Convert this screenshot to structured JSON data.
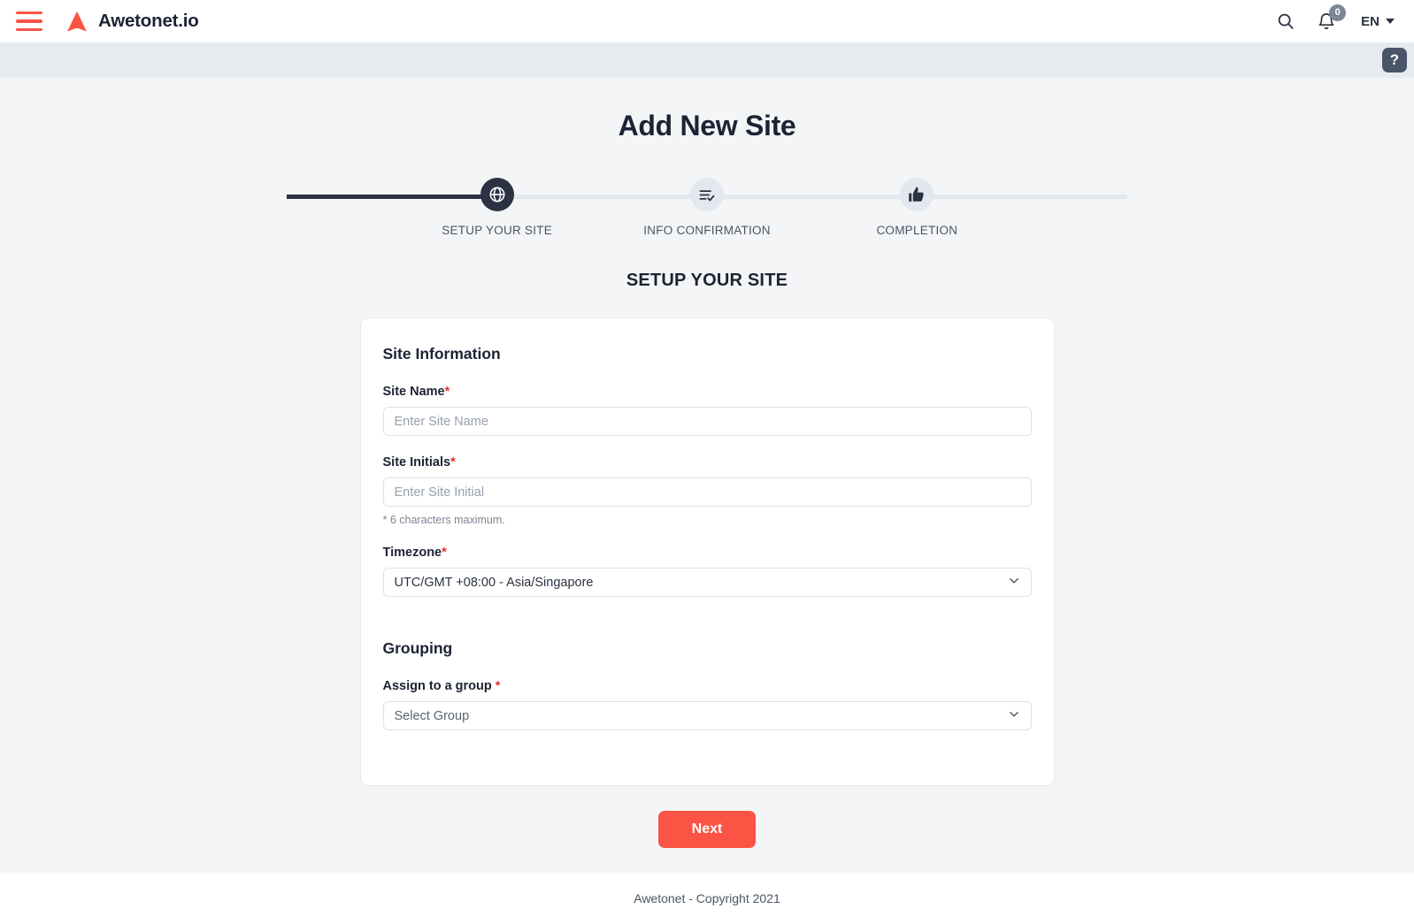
{
  "colors": {
    "accent": "#FB5445",
    "dark": "#2B3242",
    "step_inactive": "#E3E7EE",
    "page_bg": "#F4F5F7",
    "subbar_bg": "#E7EBEF",
    "required_star": "#E8312F",
    "help_btn": "#4A5568"
  },
  "header": {
    "menu_icon": "hamburger-menu-icon",
    "brand": "Awetonet.io",
    "brand_mark": "awetonet-logo-arrow-icon",
    "search_icon": "search-icon",
    "notification_icon": "bell-icon",
    "notification_count": "0",
    "language": "EN",
    "language_caret": "chevron-down-icon"
  },
  "subbar": {
    "help_label": "?",
    "help_icon": "question-mark-icon"
  },
  "main": {
    "page_title": "Add New Site",
    "section_title": "SETUP YOUR SITE"
  },
  "stepper": {
    "steps": [
      {
        "label": "SETUP YOUR SITE",
        "icon": "globe-icon",
        "state": "active"
      },
      {
        "label": "INFO CONFIRMATION",
        "icon": "list-check-icon",
        "state": "inactive"
      },
      {
        "label": "COMPLETION",
        "icon": "thumbs-up-icon",
        "state": "inactive"
      }
    ]
  },
  "form": {
    "site_information_heading": "Site Information",
    "site_name": {
      "label": "Site Name",
      "required_mark": "*",
      "placeholder": "Enter Site Name",
      "value": ""
    },
    "site_initials": {
      "label": "Site Initials",
      "required_mark": "*",
      "placeholder": "Enter Site Initial",
      "value": "",
      "hint": "* 6 characters maximum."
    },
    "timezone": {
      "label": "Timezone",
      "required_mark": "*",
      "value": "UTC/GMT +08:00 - Asia/Singapore",
      "chevron": "chevron-down-icon"
    },
    "grouping_heading": "Grouping",
    "assign_group": {
      "label": "Assign to a group ",
      "required_mark": "*",
      "value": "Select Group",
      "chevron": "chevron-down-icon"
    },
    "next_label": "Next"
  },
  "footer": {
    "copyright": "Awetonet - Copyright 2021"
  }
}
